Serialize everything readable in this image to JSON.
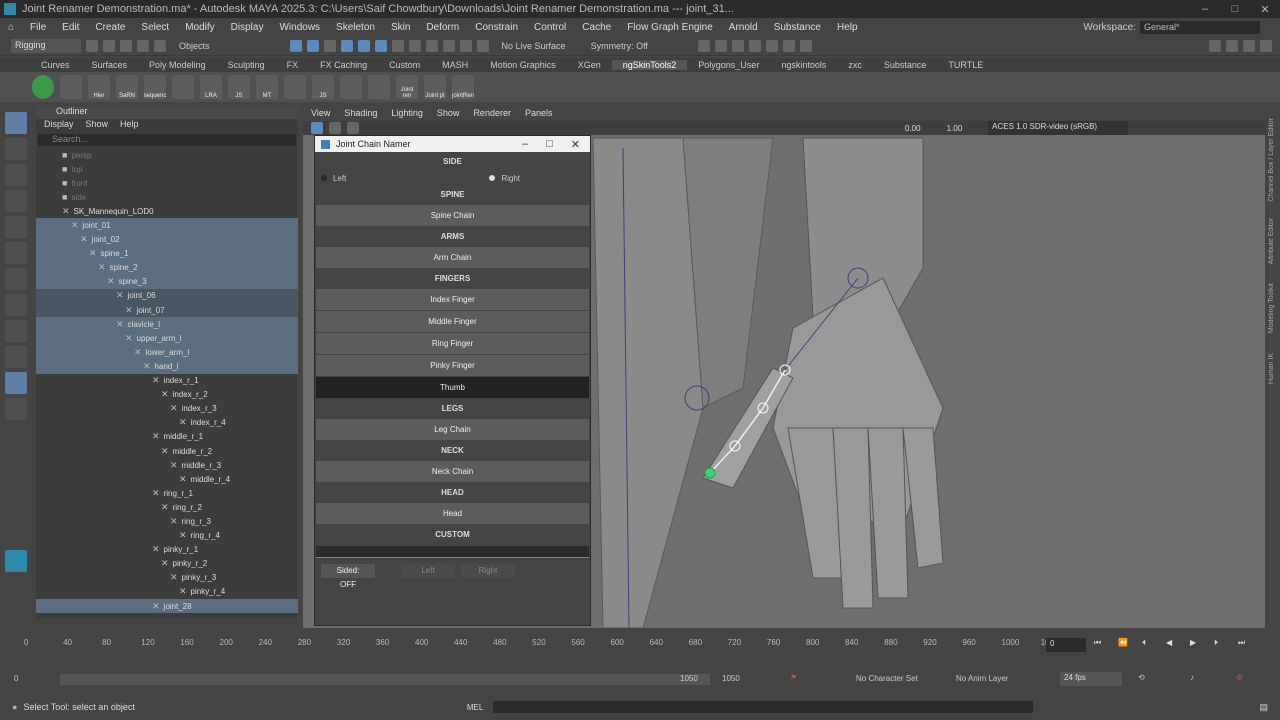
{
  "window": {
    "title": "Joint Renamer Demonstration.ma* - Autodesk MAYA 2025.3: C:\\Users\\Saif Chowdbury\\Downloads\\Joint Renamer Demonstration.ma  ---  joint_31..."
  },
  "menubar": {
    "items": [
      "File",
      "Edit",
      "Create",
      "Select",
      "Modify",
      "Display",
      "Windows",
      "Skeleton",
      "Skin",
      "Deform",
      "Constrain",
      "Control",
      "Cache",
      "Flow Graph Engine",
      "Arnold",
      "Substance",
      "Help"
    ],
    "workspace_label": "Workspace:",
    "workspace_value": "General*"
  },
  "statusline": {
    "mode": "Rigging",
    "selection_mode": "Objects",
    "live_surface": "No Live Surface",
    "symmetry": "Symmetry: Off"
  },
  "shelf": {
    "tabs": [
      "Curves",
      "Surfaces",
      "Poly Modeling",
      "Sculpting",
      "FX",
      "FX Caching",
      "Custom",
      "MASH",
      "Motion Graphics",
      "XGen",
      "ngSkinTools2",
      "Polygons_User",
      "ngskintools",
      "zxc",
      "Substance",
      "TURTLE"
    ],
    "active_tab": "ngSkinTools2",
    "buttons": [
      "",
      "",
      "Hier",
      "SaRN",
      "sequenc",
      "",
      "",
      "LRA",
      "JS",
      "MT",
      "",
      "JS",
      "",
      "",
      "Joint ren",
      "Joint pl",
      "jointRen"
    ]
  },
  "outliner": {
    "title": "Outliner",
    "menu": [
      "Display",
      "Show",
      "Help"
    ],
    "search_placeholder": "Search...",
    "rows": [
      {
        "label": "persp",
        "depth": 0,
        "style": "dim"
      },
      {
        "label": "top",
        "depth": 0,
        "style": "dim"
      },
      {
        "label": "front",
        "depth": 0,
        "style": "dim"
      },
      {
        "label": "side",
        "depth": 0,
        "style": "dim"
      },
      {
        "label": "SK_Mannequin_LOD0",
        "depth": 0,
        "style": ""
      },
      {
        "label": "joint_01",
        "depth": 1,
        "style": "sel"
      },
      {
        "label": "joint_02",
        "depth": 2,
        "style": "sel"
      },
      {
        "label": "spine_1",
        "depth": 3,
        "style": "sel"
      },
      {
        "label": "spine_2",
        "depth": 4,
        "style": "sel"
      },
      {
        "label": "spine_3",
        "depth": 5,
        "style": "sel"
      },
      {
        "label": "joint_06",
        "depth": 6,
        "style": "hl"
      },
      {
        "label": "joint_07",
        "depth": 7,
        "style": "hl"
      },
      {
        "label": "clavicle_l",
        "depth": 6,
        "style": "sel"
      },
      {
        "label": "upper_arm_l",
        "depth": 7,
        "style": "sel"
      },
      {
        "label": "lower_arm_l",
        "depth": 8,
        "style": "sel"
      },
      {
        "label": "hand_l",
        "depth": 9,
        "style": "sel"
      },
      {
        "label": "index_r_1",
        "depth": 10,
        "style": ""
      },
      {
        "label": "index_r_2",
        "depth": 11,
        "style": ""
      },
      {
        "label": "index_r_3",
        "depth": 12,
        "style": ""
      },
      {
        "label": "index_r_4",
        "depth": 13,
        "style": ""
      },
      {
        "label": "middle_r_1",
        "depth": 10,
        "style": ""
      },
      {
        "label": "middle_r_2",
        "depth": 11,
        "style": ""
      },
      {
        "label": "middle_r_3",
        "depth": 12,
        "style": ""
      },
      {
        "label": "middle_r_4",
        "depth": 13,
        "style": ""
      },
      {
        "label": "ring_r_1",
        "depth": 10,
        "style": ""
      },
      {
        "label": "ring_r_2",
        "depth": 11,
        "style": ""
      },
      {
        "label": "ring_r_3",
        "depth": 12,
        "style": ""
      },
      {
        "label": "ring_r_4",
        "depth": 13,
        "style": ""
      },
      {
        "label": "pinky_r_1",
        "depth": 10,
        "style": ""
      },
      {
        "label": "pinky_r_2",
        "depth": 11,
        "style": ""
      },
      {
        "label": "pinky_r_3",
        "depth": 12,
        "style": ""
      },
      {
        "label": "pinky_r_4",
        "depth": 13,
        "style": ""
      },
      {
        "label": "joint_28",
        "depth": 10,
        "style": "sel"
      }
    ]
  },
  "viewport": {
    "menu": [
      "View",
      "Shading",
      "Lighting",
      "Show",
      "Renderer",
      "Panels"
    ],
    "exposure": "0.00",
    "gamma": "1.00",
    "color_space": "ACES 1.0 SDR-video (sRGB)",
    "right_tabs": [
      "Channel Box / Layer Editor",
      "Attribute Editor",
      "Modeling Toolkit",
      "Human IK"
    ]
  },
  "dialog": {
    "title": "Joint Chain Namer",
    "side_header": "SIDE",
    "side_left": "Left",
    "side_right": "Right",
    "spine_header": "SPINE",
    "spine_chain": "Spine Chain",
    "arms_header": "ARMS",
    "arm_chain": "Arm Chain",
    "fingers_header": "FINGERS",
    "index_finger": "Index Finger",
    "middle_finger": "Middle Finger",
    "ring_finger": "Ring Finger",
    "pinky_finger": "Pinky Finger",
    "thumb": "Thumb",
    "legs_header": "LEGS",
    "leg_chain": "Leg Chain",
    "neck_header": "NECK",
    "neck_chain": "Neck Chain",
    "head_header": "HEAD",
    "head": "Head",
    "custom_header": "CUSTOM",
    "custom_value": "",
    "sided_btn": "Sided: OFF",
    "sided_left": "Left",
    "sided_right": "Right"
  },
  "timeline": {
    "ticks": [
      "0",
      "40",
      "80",
      "120",
      "160",
      "200",
      "240",
      "280",
      "320",
      "360",
      "400",
      "440",
      "480",
      "520",
      "560",
      "600",
      "640",
      "680",
      "720",
      "760",
      "800",
      "840",
      "880",
      "920",
      "960",
      "1000",
      "10"
    ],
    "current_frame": "0",
    "range_start": "0",
    "range_inner_start": "0",
    "range_inner_end": "1050",
    "range_end": "1050",
    "character_set": "No Character Set",
    "anim_layer": "No Anim Layer",
    "fps": "24 fps"
  },
  "helpline": {
    "text": "Select Tool: select an object",
    "mel": "MEL"
  },
  "colors": {
    "selection_blue": "#5b6d80",
    "accent_blue": "#5a8ac0",
    "joint_green": "#3fd07a"
  }
}
